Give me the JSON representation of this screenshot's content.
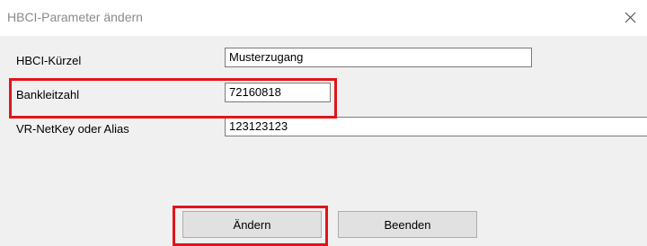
{
  "window": {
    "title": "HBCI-Parameter ändern",
    "close_icon": "close-icon"
  },
  "form": {
    "rows": [
      {
        "label": "HBCI-Kürzel",
        "value": "Musterzugang"
      },
      {
        "label": "Bankleitzahl",
        "value": "72160818"
      },
      {
        "label": "VR-NetKey oder Alias",
        "value": "123123123"
      }
    ]
  },
  "buttons": {
    "change": "Ändern",
    "quit": "Beenden"
  },
  "colors": {
    "highlight": "#e0151b",
    "dialog_background": "#f0f0f0",
    "title_text": "#8a8a8a"
  }
}
